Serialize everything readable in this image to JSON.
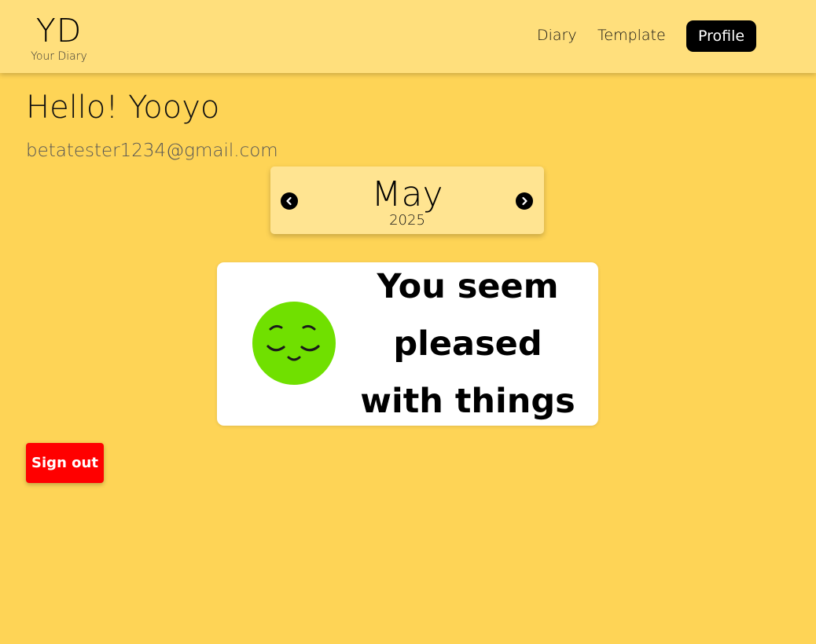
{
  "header": {
    "logo_title": "YD",
    "logo_subtitle": "Your Diary",
    "nav": {
      "diary": "Diary",
      "template": "Template",
      "profile": "Profile"
    }
  },
  "profile": {
    "greeting": "Hello! Yooyo",
    "email": "betatester1234@gmail.com"
  },
  "month_selector": {
    "month": "May",
    "year": "2025",
    "prev_icon": "chevron-left-icon",
    "next_icon": "chevron-right-icon"
  },
  "mood": {
    "icon": "relieved-face-icon",
    "message": "You seem pleased with things"
  },
  "actions": {
    "sign_out": "Sign out"
  },
  "colors": {
    "page_bg": "#fed456",
    "header_bg": "#ffdf7c",
    "month_box_bg": "#ffe491",
    "mood_face": "#70e000",
    "sign_out_bg": "#ff0000",
    "profile_button_bg": "#000000"
  }
}
